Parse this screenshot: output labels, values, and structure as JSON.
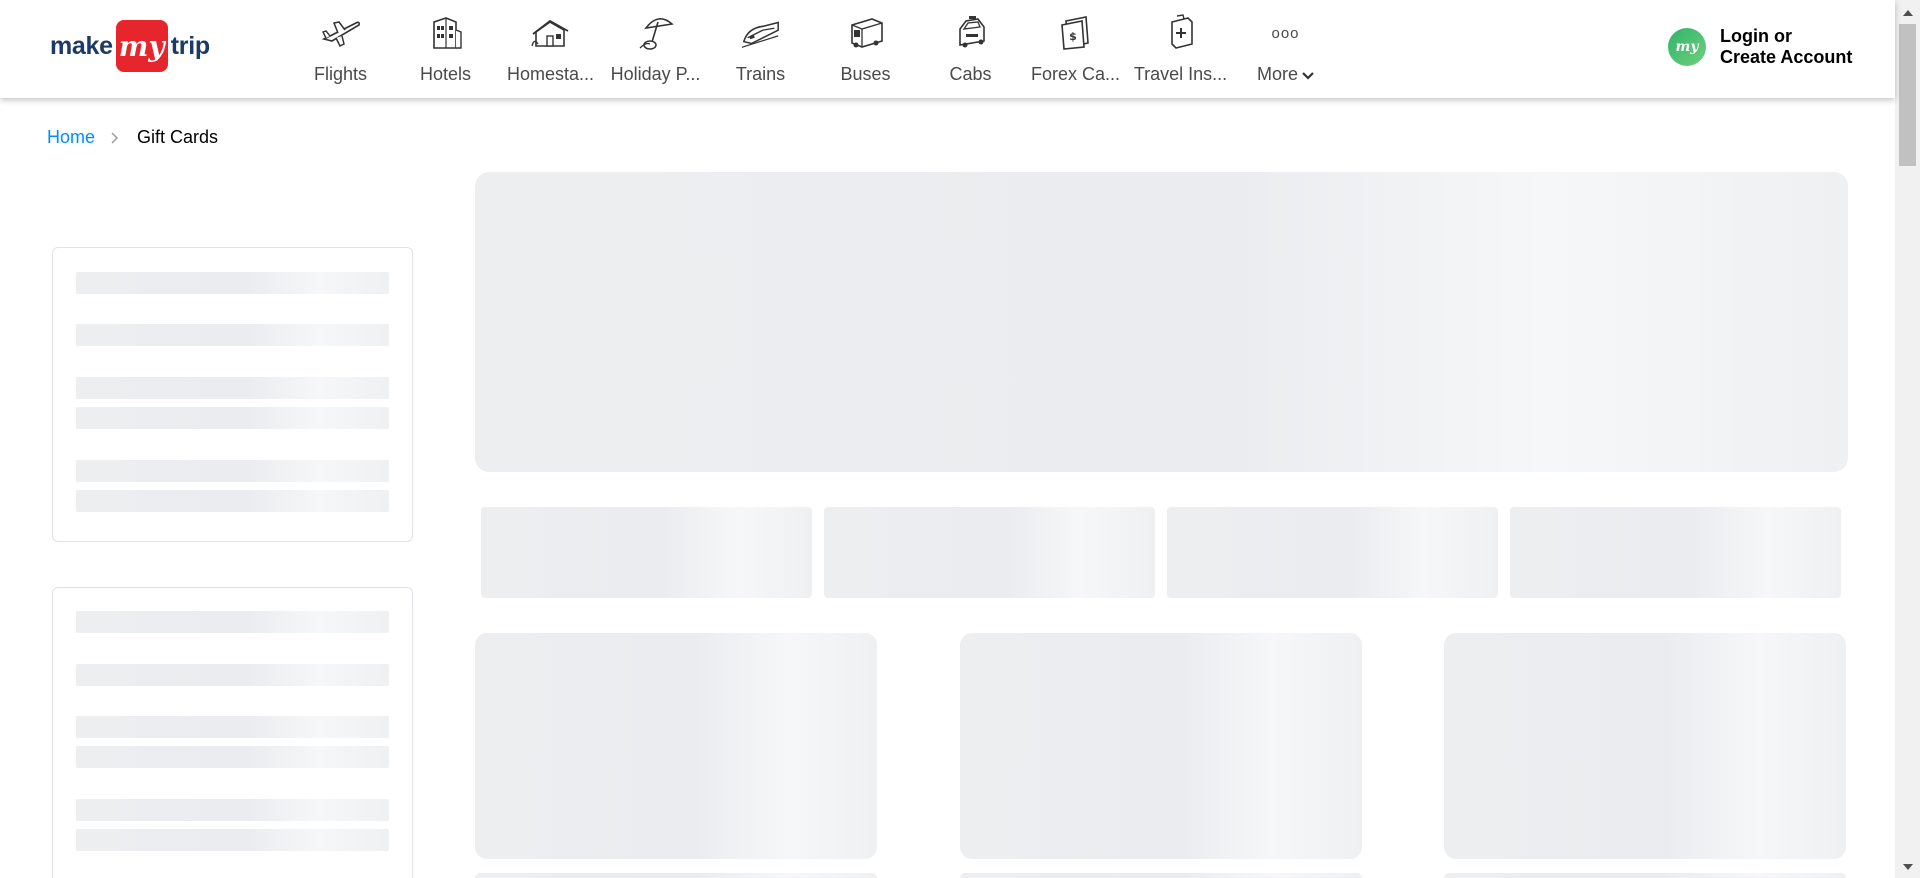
{
  "logo": {
    "word1": "make",
    "badge": "my",
    "word2": "trip"
  },
  "nav": [
    {
      "label": "Flights",
      "icon": "flight-icon"
    },
    {
      "label": "Hotels",
      "icon": "hotel-icon"
    },
    {
      "label": "Homesta...",
      "icon": "homestay-icon"
    },
    {
      "label": "Holiday P...",
      "icon": "holiday-package-icon"
    },
    {
      "label": "Trains",
      "icon": "train-icon"
    },
    {
      "label": "Buses",
      "icon": "bus-icon"
    },
    {
      "label": "Cabs",
      "icon": "cab-icon"
    },
    {
      "label": "Forex Ca...",
      "icon": "forex-card-icon"
    },
    {
      "label": "Travel Ins...",
      "icon": "travel-insurance-icon"
    },
    {
      "label": "More",
      "icon": "more-dots-icon"
    }
  ],
  "more_dots": "ooo",
  "login": {
    "avatar_text": "my",
    "line1": "Login or",
    "line2": "Create Account"
  },
  "breadcrumb": {
    "home": "Home",
    "current": "Gift Cards"
  },
  "colors": {
    "brand_navy": "#1b3a67",
    "brand_red": "#e7252d",
    "link_blue": "#008cff",
    "skeleton": "#eceef0"
  }
}
